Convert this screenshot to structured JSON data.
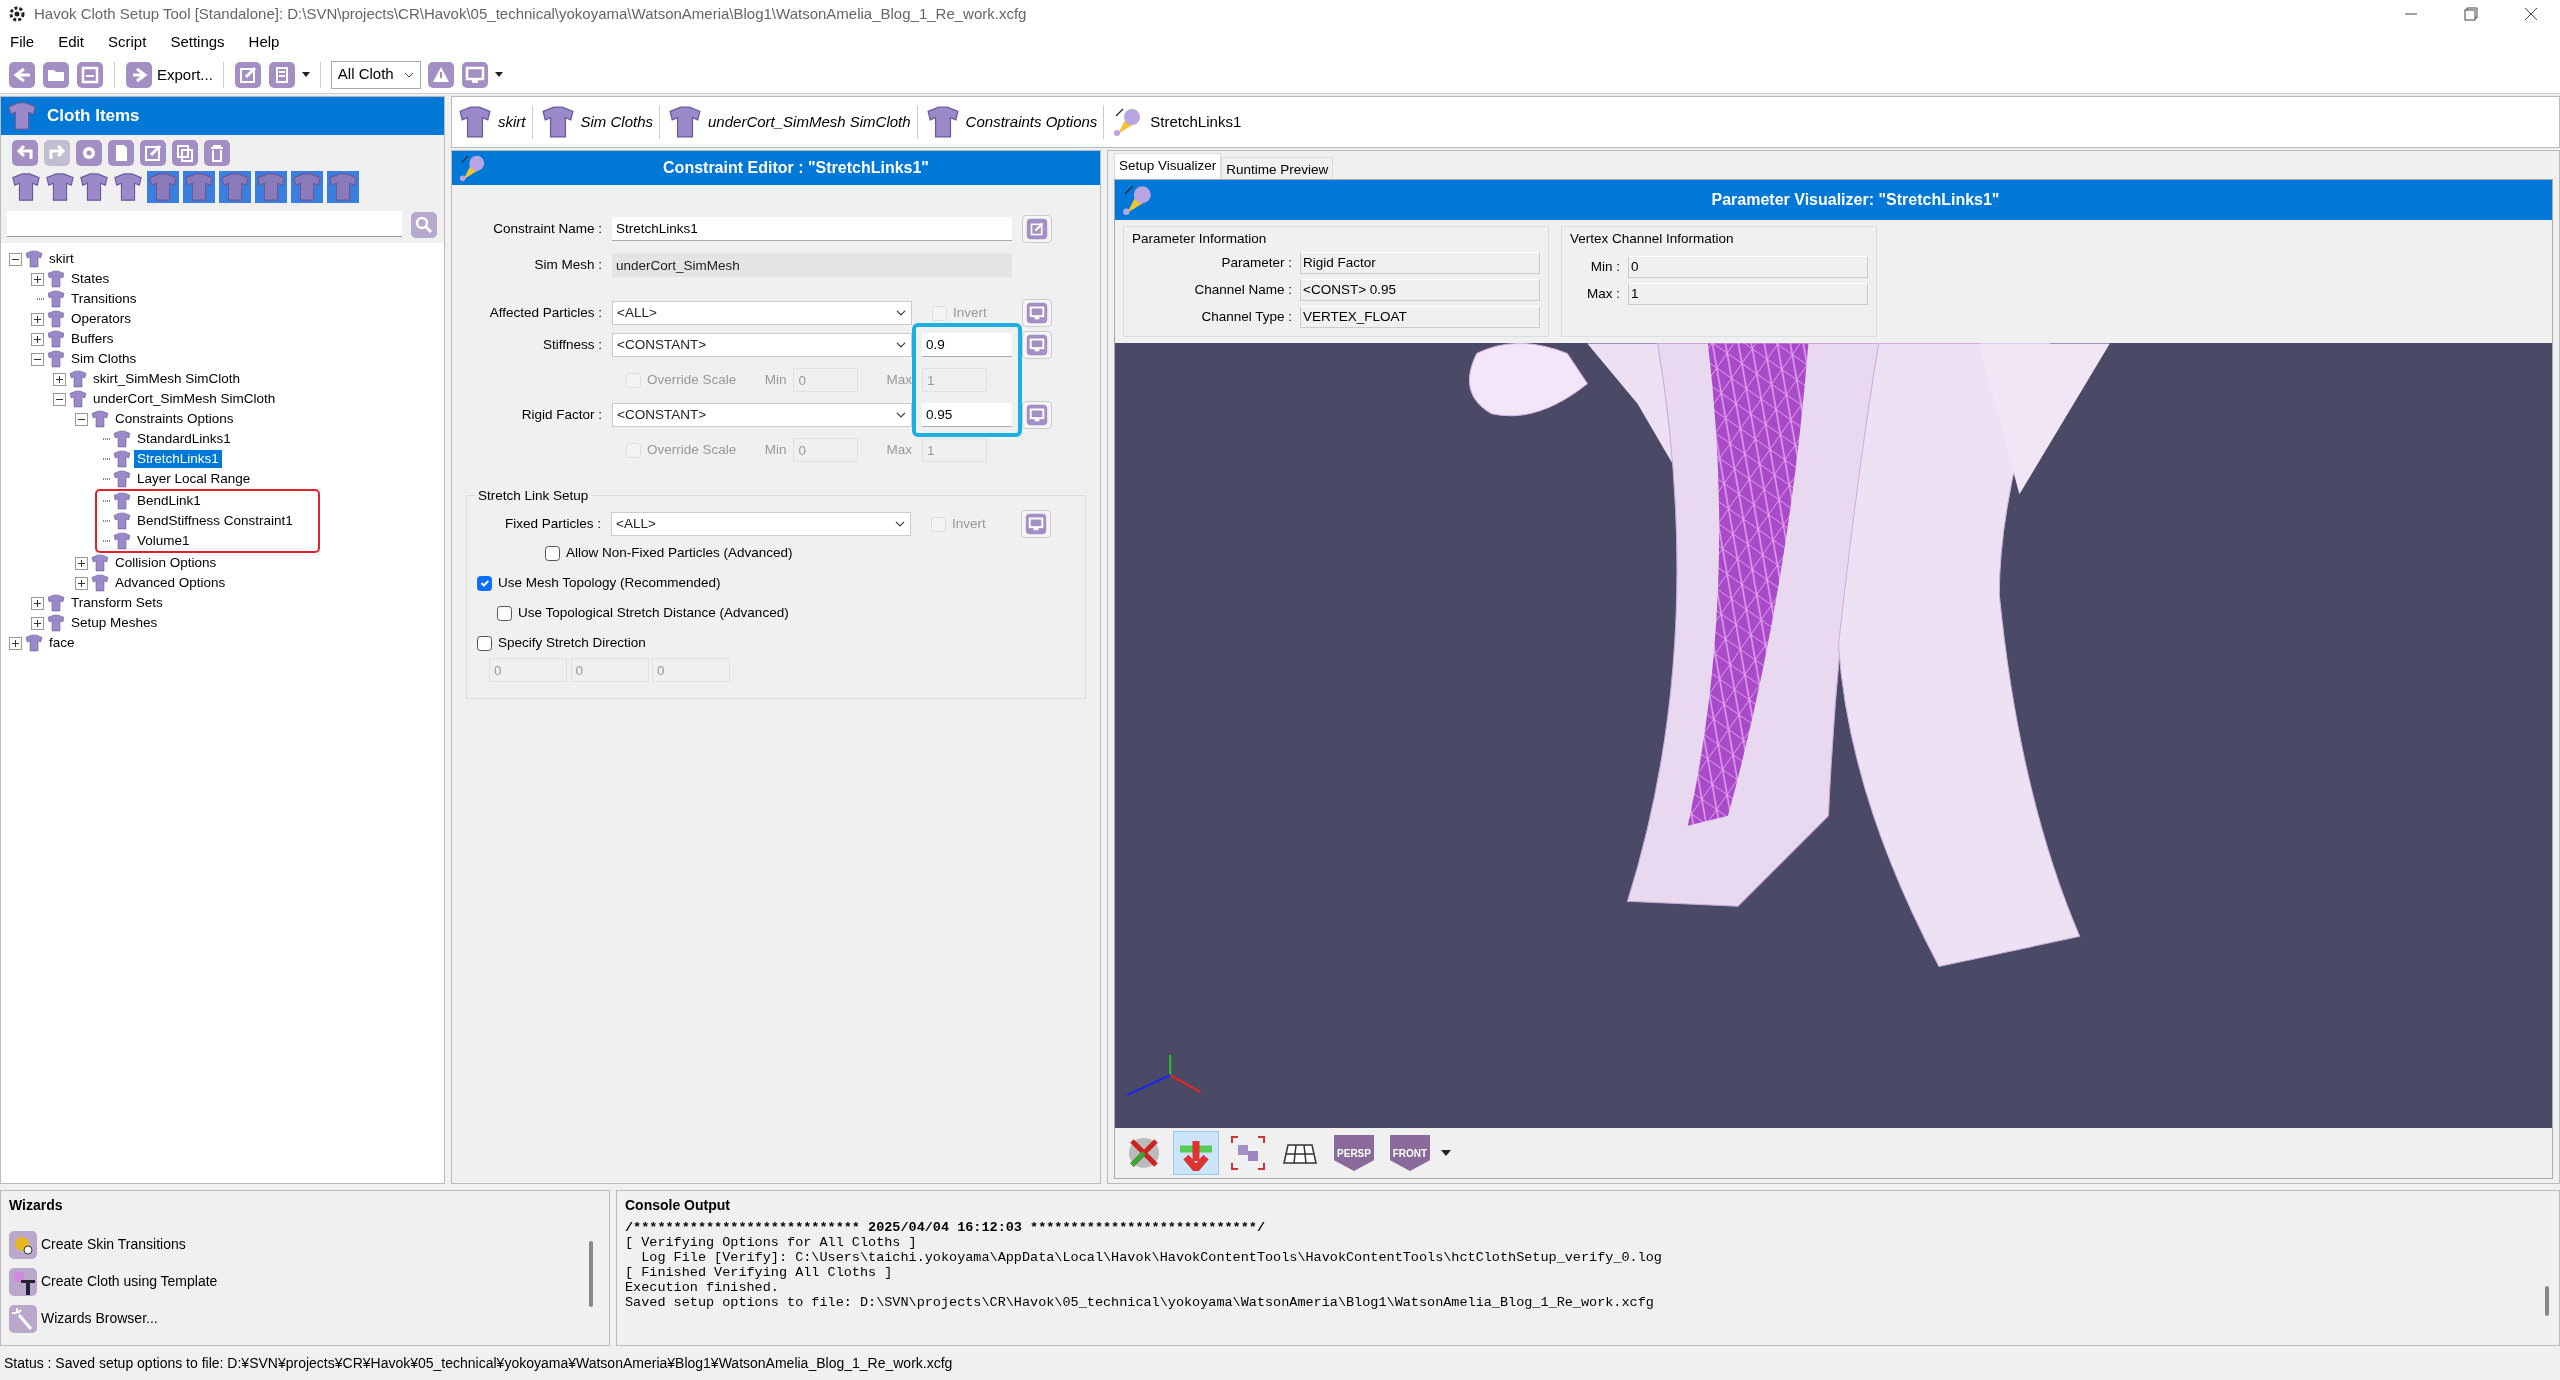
{
  "window": {
    "title": "Havok Cloth Setup Tool [Standalone]: D:\\SVN\\projects\\CR\\Havok\\05_technical\\yokoyama\\WatsonAmeria\\Blog1\\WatsonAmelia_Blog_1_Re_work.xcfg"
  },
  "menu": [
    "File",
    "Edit",
    "Script",
    "Settings",
    "Help"
  ],
  "toolbar": {
    "export_label": "Export...",
    "filter": "All Cloth"
  },
  "cloth_items": {
    "title": "Cloth Items"
  },
  "tree": [
    {
      "label": "skirt",
      "kind": "branch",
      "expanded": true,
      "selected": false,
      "children": [
        {
          "label": "States",
          "kind": "branch",
          "expanded": false,
          "selected": false
        },
        {
          "label": "Transitions",
          "kind": "leaf",
          "selected": false
        },
        {
          "label": "Operators",
          "kind": "branch",
          "expanded": false,
          "selected": false
        },
        {
          "label": "Buffers",
          "kind": "branch",
          "expanded": false,
          "selected": false
        },
        {
          "label": "Sim Cloths",
          "kind": "branch",
          "expanded": true,
          "selected": false,
          "children": [
            {
              "label": "skirt_SimMesh SimCloth",
              "kind": "branch",
              "expanded": false,
              "selected": false
            },
            {
              "label": "underCort_SimMesh SimCloth",
              "kind": "branch",
              "expanded": true,
              "selected": false,
              "children": [
                {
                  "label": "Constraints Options",
                  "kind": "branch",
                  "expanded": true,
                  "selected": false,
                  "children": [
                    {
                      "label": "StandardLinks1",
                      "kind": "leaf",
                      "selected": false,
                      "highlighted": false
                    },
                    {
                      "label": "StretchLinks1",
                      "kind": "leaf",
                      "selected": true,
                      "highlighted": false
                    },
                    {
                      "label": "Layer Local Range",
                      "kind": "leaf",
                      "selected": false,
                      "highlighted": false
                    },
                    {
                      "label": "BendLink1",
                      "kind": "leaf",
                      "selected": false,
                      "highlighted": true
                    },
                    {
                      "label": "BendStiffness Constraint1",
                      "kind": "leaf",
                      "selected": false,
                      "highlighted": true
                    },
                    {
                      "label": "Volume1",
                      "kind": "leaf",
                      "selected": false,
                      "highlighted": true
                    }
                  ]
                },
                {
                  "label": "Collision Options",
                  "kind": "branch",
                  "expanded": false,
                  "selected": false
                },
                {
                  "label": "Advanced Options",
                  "kind": "branch",
                  "expanded": false,
                  "selected": false
                }
              ]
            }
          ]
        },
        {
          "label": "Transform Sets",
          "kind": "branch",
          "expanded": false,
          "selected": false
        },
        {
          "label": "Setup Meshes",
          "kind": "branch",
          "expanded": false,
          "selected": false
        }
      ]
    },
    {
      "label": "face",
      "kind": "branch",
      "expanded": false,
      "selected": false
    }
  ],
  "breadcrumbs": [
    {
      "label": "skirt",
      "current": false
    },
    {
      "label": "Sim Cloths",
      "current": false
    },
    {
      "label": "underCort_SimMesh SimCloth",
      "current": false
    },
    {
      "label": "Constraints Options",
      "current": false
    },
    {
      "label": "StretchLinks1",
      "current": true
    }
  ],
  "editor": {
    "title": "Constraint Editor : \"StretchLinks1\"",
    "constraint_name": {
      "label": "Constraint Name :",
      "value": "StretchLinks1",
      "disabled": false
    },
    "sim_mesh": {
      "label": "Sim Mesh :",
      "value": "underCort_SimMesh",
      "disabled": true
    },
    "affected_particles": {
      "label": "Affected Particles :",
      "value": "<ALL>",
      "invert": {
        "label": "Invert",
        "checked": false,
        "disabled": true
      }
    },
    "value_highlight": true,
    "params": [
      {
        "label": "Stiffness :",
        "mode": "<CONSTANT>",
        "value": "0.9",
        "override": {
          "label": "Override Scale",
          "checked": false,
          "disabled": true
        },
        "min_label": "Min",
        "min": "0",
        "max_label": "Max",
        "max": "1"
      },
      {
        "label": "Rigid Factor :",
        "mode": "<CONSTANT>",
        "value": "0.95",
        "override": {
          "label": "Override Scale",
          "checked": false,
          "disabled": true
        },
        "min_label": "Min",
        "min": "0",
        "max_label": "Max",
        "max": "1"
      }
    ],
    "stretch_link_setup": {
      "title": "Stretch Link Setup",
      "fixed_particles": {
        "label": "Fixed Particles :",
        "value": "<ALL>",
        "invert": {
          "label": "Invert",
          "checked": false,
          "disabled": true
        },
        "allow_non_fixed": {
          "label": "Allow Non-Fixed Particles (Advanced)",
          "checked": false
        }
      },
      "options": [
        {
          "label": "Use Mesh Topology (Recommended)",
          "checked": true,
          "children": [
            {
              "label": "Use Topological Stretch Distance (Advanced)",
              "checked": false
            }
          ]
        },
        {
          "label": "Specify Stretch Direction",
          "checked": false
        }
      ],
      "direction": [
        "0",
        "0",
        "0"
      ]
    }
  },
  "visualizer": {
    "tabs": [
      {
        "label": "Setup Visualizer",
        "selected": true
      },
      {
        "label": "Runtime Preview",
        "selected": false
      }
    ],
    "title": "Parameter Visualizer: \"StretchLinks1\"",
    "parameter_info": {
      "title": "Parameter Information",
      "rows": [
        {
          "label": "Parameter :",
          "value": "Rigid Factor"
        },
        {
          "label": "Channel Name :",
          "value": "<CONST> 0.95"
        },
        {
          "label": "Channel Type :",
          "value": "VERTEX_FLOAT"
        }
      ]
    },
    "vertex_channel_info": {
      "title": "Vertex Channel Information",
      "rows": [
        {
          "label": "Min :",
          "value": "0"
        },
        {
          "label": "Max :",
          "value": "1"
        }
      ]
    },
    "viewport_tools": [
      {
        "kind": "orbit",
        "pressed": false
      },
      {
        "kind": "move",
        "pressed": true
      },
      {
        "kind": "frame",
        "pressed": false
      },
      {
        "kind": "grid",
        "pressed": false
      },
      {
        "kind": "view",
        "label": "PERSP",
        "pressed": false
      },
      {
        "kind": "view",
        "label": "FRONT",
        "pressed": false,
        "has_menu": true
      }
    ]
  },
  "wizards": {
    "title": "Wizards",
    "items": [
      "Create Skin Transitions",
      "Create Cloth using Template",
      "Wizards Browser..."
    ]
  },
  "console": {
    "title": "Console Output",
    "lines": [
      {
        "kind": "header",
        "text": "/**************************** 2025/04/04 16:12:03 ****************************/"
      },
      {
        "kind": "log",
        "text": "[ Verifying Options for All Cloths ]"
      },
      {
        "kind": "log",
        "text": "  Log File [Verify]: C:\\Users\\taichi.yokoyama\\AppData\\Local\\Havok\\HavokContentTools\\HavokContentTools\\hctClothSetup_verify_0.log"
      },
      {
        "kind": "log",
        "text": "[ Finished Verifying All Cloths ]"
      },
      {
        "kind": "log",
        "text": "Execution finished."
      },
      {
        "kind": "log",
        "text": "Saved setup options to file: D:\\SVN\\projects\\CR\\Havok\\05_technical\\yokoyama\\WatsonAmeria\\Blog1\\WatsonAmelia_Blog_1_Re_work.xcfg"
      }
    ]
  },
  "status_bar": "Status : Saved setup options to file: D:¥SVN¥projects¥CR¥Havok¥05_technical¥yokoyama¥WatsonAmeria¥Blog1¥WatsonAmelia_Blog_1_Re_work.xcfg"
}
